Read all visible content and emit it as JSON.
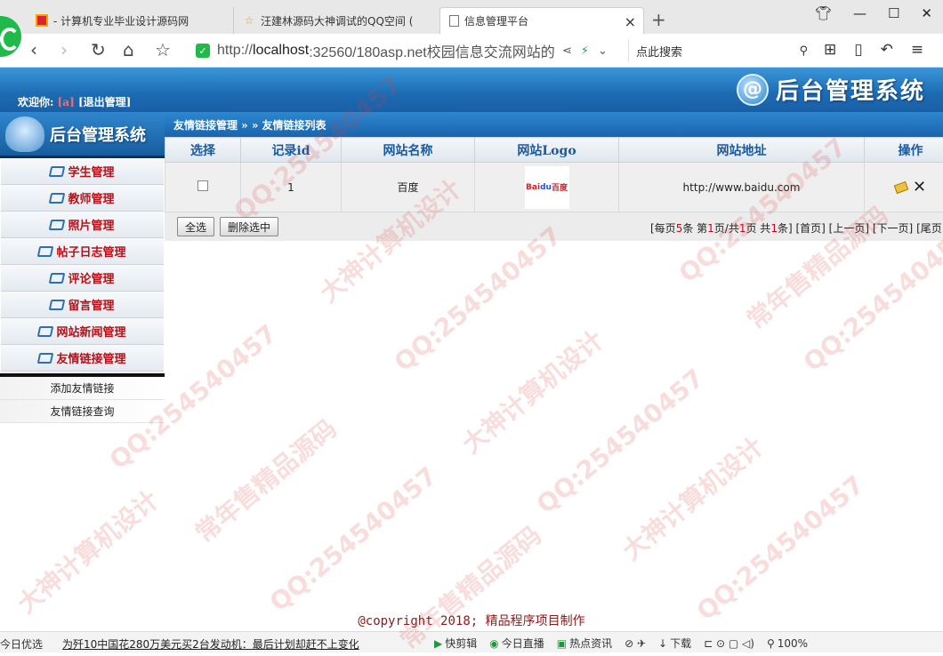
{
  "browser": {
    "tabs": [
      {
        "title": "- 计算机专业毕业设计源码网"
      },
      {
        "title": "汪建林源码大神调试的QQ空间 ("
      },
      {
        "title": "信息管理平台"
      }
    ],
    "url_scheme": "http://",
    "url_host": "localhost",
    "url_rest": ":32560/180asp.net校园信息交流网站的",
    "search_placeholder": "点此搜索"
  },
  "header": {
    "welcome_label": "欢迎你:",
    "username": "[a]",
    "logout": "[退出管理]",
    "title": "后台管理系统",
    "logo_glyph": "@"
  },
  "sidebar": {
    "logo_title": "后台管理系统",
    "menu": [
      {
        "label": "学生管理"
      },
      {
        "label": "教师管理"
      },
      {
        "label": "照片管理"
      },
      {
        "label": "帖子日志管理"
      },
      {
        "label": "评论管理"
      },
      {
        "label": "留言管理"
      },
      {
        "label": "网站新闻管理"
      },
      {
        "label": "友情链接管理"
      }
    ],
    "submenu": [
      {
        "label": "添加友情链接"
      },
      {
        "label": "友情链接查询"
      }
    ]
  },
  "content": {
    "breadcrumb": "友情链接管理 » » 友情链接列表",
    "columns": [
      "选择",
      "记录id",
      "网站名称",
      "网站Logo",
      "网站地址",
      "操作"
    ],
    "rows": [
      {
        "id": "1",
        "name": "百度",
        "logo_text": "Bai",
        "logo_paw": "du",
        "logo_cn": "百度",
        "url": "http://www.baidu.com"
      }
    ],
    "select_all": "全选",
    "delete_selected": "删除选中",
    "pager": {
      "p1": "[每页",
      "per_page": "5",
      "p2": "条 第",
      "cur_page": "1",
      "p3": "页/共",
      "total_pages": "1",
      "p4": "页 共",
      "total": "1",
      "p5": "条]",
      "first": "[首页]",
      "prev": "[上一页]",
      "next": "[下一页]",
      "last": "[尾页]"
    }
  },
  "footer": "@copyright 2018; 精品程序项目制作",
  "statusbar": {
    "left": "今日优选",
    "news": "为歼10中国花280万美元买2台发动机：最后计划却赶不上变化",
    "items": [
      "快剪辑",
      "今日直播",
      "热点资讯",
      "下载",
      "100%"
    ]
  },
  "watermarks": [
    "QQ:254540457",
    "大神计算机设计",
    "常年售精品源码"
  ],
  "colors": {
    "accent_blue": "#1c6bb3",
    "menu_red": "#b3121a",
    "header_link": "#1a5aa0"
  }
}
